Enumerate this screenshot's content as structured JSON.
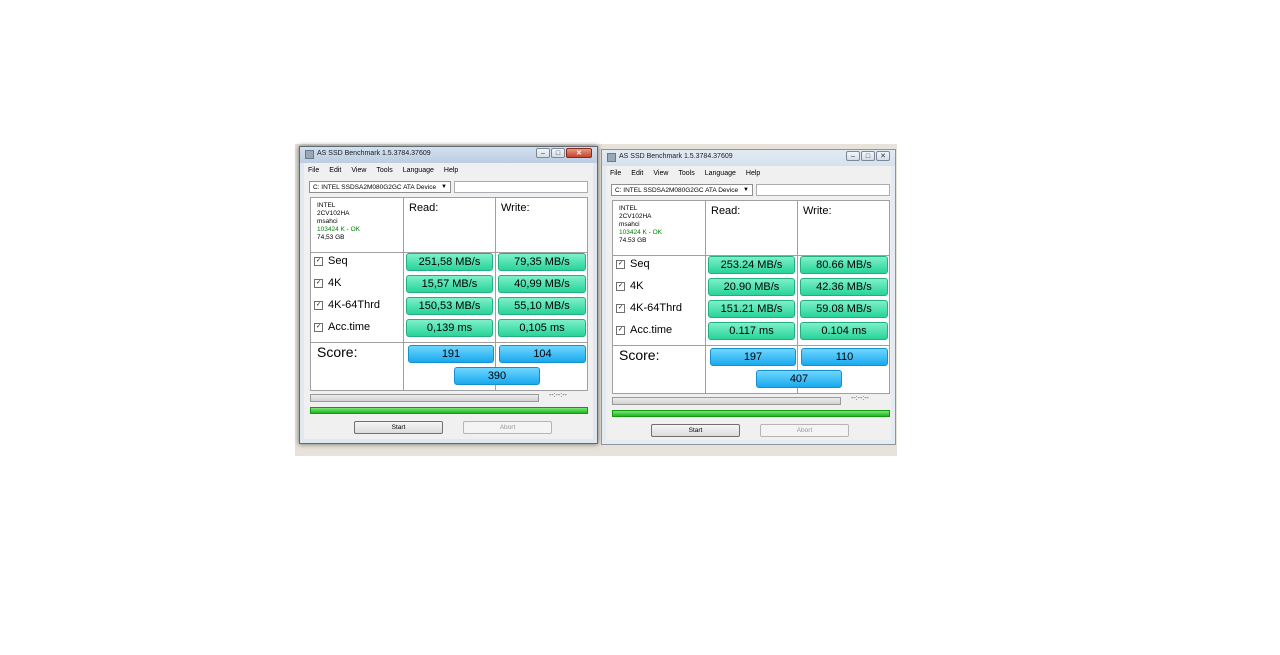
{
  "windows": [
    {
      "title": "AS SSD Benchmark 1.5.3784.37609",
      "menu": [
        "File",
        "Edit",
        "View",
        "Tools",
        "Language",
        "Help"
      ],
      "drive": "C: INTEL SSDSA2M080G2GC ATA Device",
      "info": [
        "INTEL",
        "2CV102HA",
        "msahci",
        "103424 K - OK",
        "74,53 GB"
      ],
      "read_header": "Read:",
      "write_header": "Write:",
      "rows": [
        {
          "label": "Seq",
          "read": "251,58 MB/s",
          "write": "79,35 MB/s"
        },
        {
          "label": "4K",
          "read": "15,57 MB/s",
          "write": "40,99 MB/s"
        },
        {
          "label": "4K-64Thrd",
          "read": "150,53 MB/s",
          "write": "55,10 MB/s"
        },
        {
          "label": "Acc.time",
          "read": "0,139 ms",
          "write": "0,105 ms"
        }
      ],
      "score_label": "Score:",
      "score_read": "191",
      "score_write": "104",
      "score_total": "390",
      "timer": "--:--:--",
      "start_label": "Start",
      "abort_label": "Abort"
    },
    {
      "title": "AS SSD Benchmark 1.5.3784.37609",
      "menu": [
        "File",
        "Edit",
        "View",
        "Tools",
        "Language",
        "Help"
      ],
      "drive": "C: INTEL SSDSA2M080G2GC ATA Device",
      "info": [
        "INTEL",
        "2CV102HA",
        "msahci",
        "103424 K - OK",
        "74.53 GB"
      ],
      "read_header": "Read:",
      "write_header": "Write:",
      "rows": [
        {
          "label": "Seq",
          "read": "253.24 MB/s",
          "write": "80.66 MB/s"
        },
        {
          "label": "4K",
          "read": "20.90 MB/s",
          "write": "42.36 MB/s"
        },
        {
          "label": "4K-64Thrd",
          "read": "151.21 MB/s",
          "write": "59.08 MB/s"
        },
        {
          "label": "Acc.time",
          "read": "0.117 ms",
          "write": "0.104 ms"
        }
      ],
      "score_label": "Score:",
      "score_read": "197",
      "score_write": "110",
      "score_total": "407",
      "timer": "--:--:--",
      "start_label": "Start",
      "abort_label": "Abort"
    }
  ],
  "colors": {
    "result_green": "#28d49a",
    "score_blue": "#1aa9ee",
    "progress_green": "#1fb91f"
  }
}
